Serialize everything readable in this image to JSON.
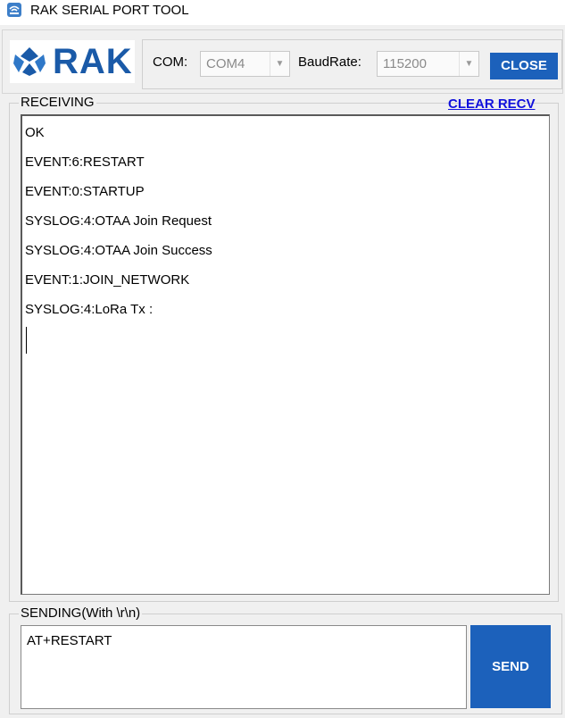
{
  "window": {
    "title": "RAK SERIAL PORT TOOL"
  },
  "header": {
    "logo_text": "RAK",
    "com_label": "COM:",
    "com_value": "COM4",
    "baud_label": "BaudRate:",
    "baud_value": "115200",
    "close_button": "CLOSE"
  },
  "receiving": {
    "label": "RECEIVING",
    "clear_link": "CLEAR RECV",
    "lines": [
      "OK",
      "EVENT:6:RESTART",
      "EVENT:0:STARTUP",
      "SYSLOG:4:OTAA Join Request",
      "SYSLOG:4:OTAA Join Success",
      "EVENT:1:JOIN_NETWORK",
      "SYSLOG:4:LoRa Tx :"
    ]
  },
  "sending": {
    "label": "SENDING(With \\r\\n)",
    "input_value": "AT+RESTART",
    "send_button": "SEND"
  },
  "colors": {
    "accent": "#1c61bb",
    "link": "#1111dd",
    "background": "#f0f0f0"
  },
  "icons": {
    "app": "rak-app-icon",
    "logo": "rak-logo-mark",
    "dropdown": "chevron-down-icon"
  }
}
